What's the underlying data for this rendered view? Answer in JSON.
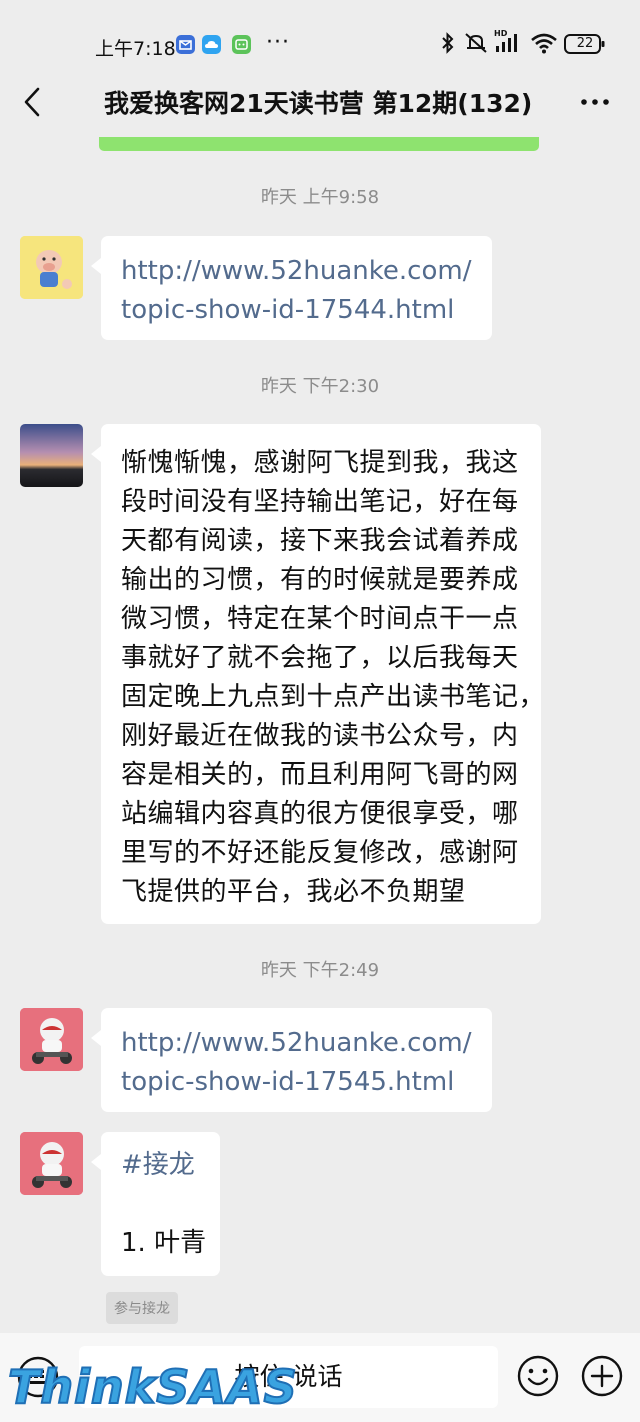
{
  "status_bar": {
    "time": "上午7:18",
    "battery": "22",
    "hd": "HD"
  },
  "header": {
    "title": "我爱换客网21天读书营 第12期(132)"
  },
  "messages": [
    {
      "timestamp": "昨天 上午9:58",
      "type": "link",
      "lines": [
        "http://www.52huanke.com/",
        "topic-show-id-17544.html"
      ]
    },
    {
      "timestamp": "昨天 下午2:30",
      "type": "text",
      "lines": [
        "惭愧惭愧，感谢阿飞提到我，我这",
        "段时间没有坚持输出笔记，好在每",
        "天都有阅读，接下来我会试着养成",
        "输出的习惯，有的时候就是要养成",
        "微习惯，特定在某个时间点干一点",
        "事就好了就不会拖了，以后我每天",
        "固定晚上九点到十点产出读书笔记，",
        "刚好最近在做我的读书公众号，内",
        "容是相关的，而且利用阿飞哥的网",
        "站编辑内容真的很方便很享受，哪",
        "里写的不好还能反复修改，感谢阿",
        "飞提供的平台，我必不负期望"
      ]
    },
    {
      "timestamp": "昨天 下午2:49",
      "type": "link",
      "lines": [
        "http://www.52huanke.com/",
        "topic-show-id-17545.html"
      ]
    },
    {
      "type": "solitaire",
      "tag": "#接龙",
      "item": "1. 叶青",
      "join_label": "参与接龙"
    }
  ],
  "input_bar": {
    "voice_label": "按住 说话"
  },
  "watermark": {
    "text": "ThinkSAAS"
  },
  "colors": {
    "background": "#ededed",
    "bubble": "#ffffff",
    "link": "#536b8d",
    "accent_bar": "#8ee36f"
  }
}
